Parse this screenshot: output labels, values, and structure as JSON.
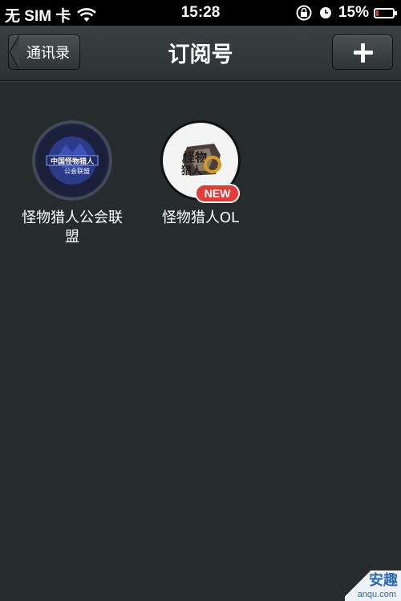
{
  "status_bar": {
    "carrier": "无 SIM 卡",
    "time": "15:28",
    "battery_percent": "15%",
    "battery_level": 0.15
  },
  "nav": {
    "back_label": "通讯录",
    "title": "订阅号",
    "add_icon": "plus-icon"
  },
  "accounts": [
    {
      "name": "怪物猎人公会联盟",
      "avatar_icon": "monster-hunter-alliance-logo",
      "badge": ""
    },
    {
      "name": "怪物猎人OL",
      "avatar_icon": "monster-hunter-ol-logo",
      "badge": "NEW"
    }
  ],
  "colors": {
    "background": "#262b2c",
    "nav_bar": "#33393a",
    "badge": "#e23b38"
  },
  "watermark": {
    "text": "安趣",
    "url_text": "anqu.com"
  }
}
